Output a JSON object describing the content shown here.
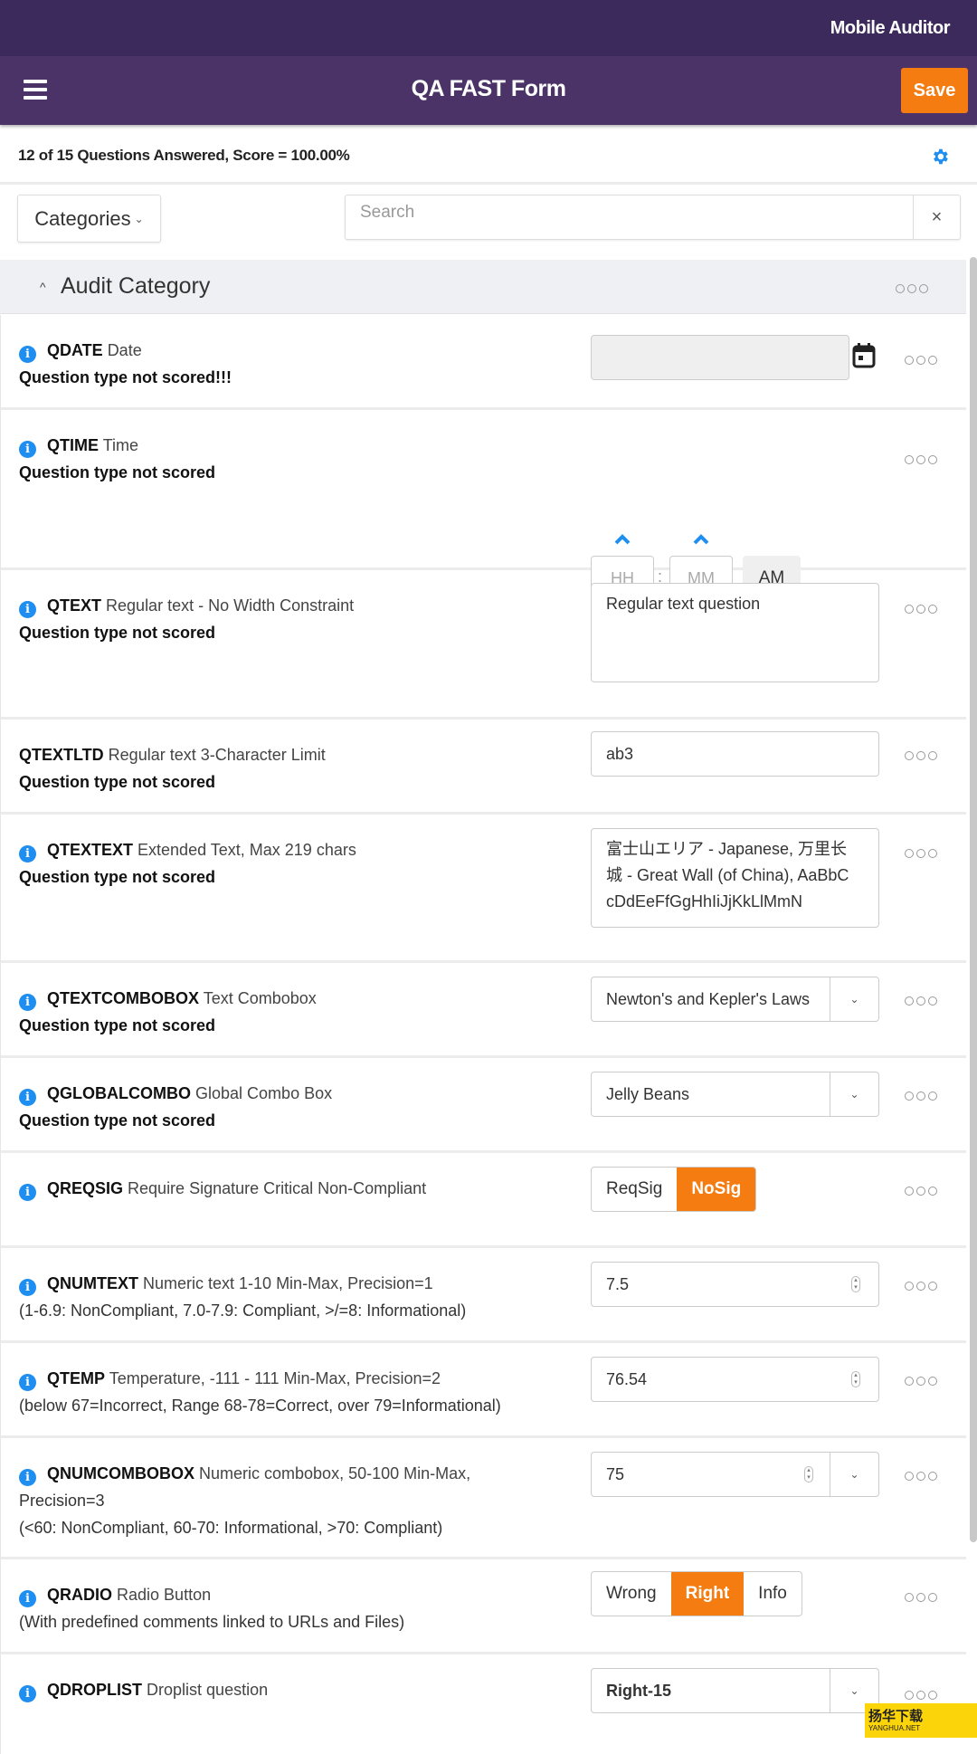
{
  "status_bar": {
    "app_name": "Mobile Auditor"
  },
  "navbar": {
    "title": "QA FAST Form",
    "save_label": "Save",
    "menu_icon": "hamburger-icon"
  },
  "summary": {
    "text": "12 of 15 Questions Answered, Score = 100.00%",
    "settings_icon": "gear-icon"
  },
  "toolbar": {
    "categories_label": "Categories",
    "search_placeholder": "Search",
    "clear_label": "×"
  },
  "category": {
    "name": "Audit Category",
    "expanded": true
  },
  "questions": [
    {
      "code": "QDATE",
      "title": "Date",
      "sub": "Question type not scored!!!",
      "type": "date",
      "value": ""
    },
    {
      "code": "QTIME",
      "title": "Time",
      "sub": "Question type not scored",
      "type": "time",
      "hh_placeholder": "HH",
      "mm_placeholder": "MM",
      "separator": ":",
      "ampm": "AM"
    },
    {
      "code": "QTEXT",
      "title": "Regular text - No Width Constraint",
      "sub": "Question type not scored",
      "type": "textarea",
      "value": "Regular text question"
    },
    {
      "code": "QTEXTLTD",
      "title": "Regular text 3-Character Limit",
      "sub": "Question type not scored",
      "type": "text",
      "value": "ab3"
    },
    {
      "code": "QTEXTEXT",
      "title": "Extended Text, Max 219 chars",
      "sub": "Question type not scored",
      "type": "textarea",
      "value": "富士山エリア - Japanese, 万里长城 - Great Wall (of China), AaBbCcDdEeFfGgHhIiJjKkLlMmN"
    },
    {
      "code": "QTEXTCOMBOBOX",
      "title": "Text Combobox",
      "sub": "Question type not scored",
      "type": "combo",
      "value": "Newton's and Kepler's Laws"
    },
    {
      "code": "QGLOBALCOMBO",
      "title": "Global Combo Box",
      "sub": "Question type not scored",
      "type": "combo",
      "value": "Jelly Beans"
    },
    {
      "code": "QREQSIG",
      "title": "Require Signature Critical Non-Compliant",
      "type": "segmented",
      "options": [
        "ReqSig",
        "NoSig"
      ],
      "selected": "NoSig"
    },
    {
      "code": "QNUMTEXT",
      "title": "Numeric text 1-10 Min-Max, Precision=1",
      "note": "(1-6.9: NonCompliant, 7.0-7.9: Compliant, >/=8: Informational)",
      "type": "number",
      "value": "7.5"
    },
    {
      "code": "QTEMP",
      "title": "Temperature, -111 - 111 Min-Max, Precision=2",
      "note": "(below 67=Incorrect, Range 68-78=Correct, over 79=Informational)",
      "type": "number",
      "value": "76.54"
    },
    {
      "code": "QNUMCOMBOBOX",
      "title": "Numeric combobox, 50-100 Min-Max,",
      "title2": "Precision=3",
      "note": "(<60: NonCompliant, 60-70: Informational, >70: Compliant)",
      "type": "numcombo",
      "value": "75"
    },
    {
      "code": "QRADIO",
      "title": "Radio Button",
      "note": "(With predefined comments linked to URLs and Files)",
      "type": "segmented",
      "options": [
        "Wrong",
        "Right",
        "Info"
      ],
      "selected": "Right"
    },
    {
      "code": "QDROPLIST",
      "title": "Droplist question",
      "type": "combo",
      "value": "Right-15"
    }
  ],
  "colors": {
    "header_dark": "#3d2a5c",
    "header": "#4b3368",
    "accent": "#f47c10",
    "info_blue": "#1e8ff0"
  },
  "watermark": {
    "title": "扬华下载",
    "subtitle": "YANGHUA.NET"
  }
}
